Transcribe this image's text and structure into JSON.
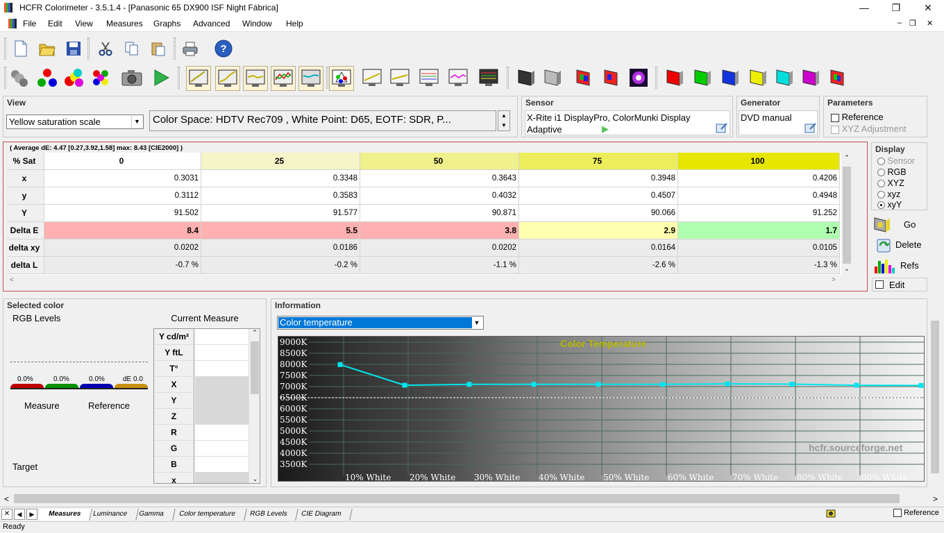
{
  "window": {
    "title": "HCFR Colorimeter - 3.5.1.4 - [Panasonic 65 DX900 ISF Night Fábrica]"
  },
  "menu": [
    "File",
    "Edit",
    "View",
    "Measures",
    "Graphs",
    "Advanced",
    "Window",
    "Help"
  ],
  "view": {
    "title": "View",
    "scale_select": "Yellow saturation scale",
    "color_space_info": "Color Space: HDTV Rec709 , White Point: D65, EOTF:  SDR, P..."
  },
  "sensor": {
    "title": "Sensor",
    "name": "X-Rite i1 DisplayPro, ColorMunki Display",
    "mode": "Adaptive"
  },
  "generator": {
    "title": "Generator",
    "name": "DVD manual"
  },
  "parameters": {
    "title": "Parameters",
    "reference": "Reference",
    "xyz_adjustment": "XYZ Adjustment"
  },
  "grid": {
    "summary": "( Average dE: 4.47 [0.27,3.92,1.58] max: 8.43 [CIE2000] )",
    "corner": "% Sat",
    "columns": [
      "0",
      "25",
      "50",
      "75",
      "100"
    ],
    "rows": [
      {
        "label": "x",
        "values": [
          "0.3031",
          "0.3348",
          "0.3643",
          "0.3948",
          "0.4206"
        ]
      },
      {
        "label": "y",
        "values": [
          "0.3112",
          "0.3583",
          "0.4032",
          "0.4507",
          "0.4948"
        ]
      },
      {
        "label": "Y",
        "values": [
          "91.502",
          "91.577",
          "90.871",
          "90.066",
          "91.252"
        ]
      },
      {
        "label": "Delta E",
        "values": [
          "8.4",
          "5.5",
          "3.8",
          "2.9",
          "1.7"
        ]
      },
      {
        "label": "delta xy",
        "values": [
          "0.0202",
          "0.0186",
          "0.0202",
          "0.0164",
          "0.0105"
        ]
      },
      {
        "label": "delta L",
        "values": [
          "-0.7 %",
          "-0.2 %",
          "-1.1 %",
          "-2.6 %",
          "-1.3 %"
        ]
      }
    ],
    "header_colors": [
      "#ffffff",
      "#f5f5c8",
      "#f0f08c",
      "#eded5c",
      "#e6e600"
    ],
    "delta_e_colors": [
      "#ffb0b0",
      "#ffb0b0",
      "#ffb0b0",
      "#ffffb0",
      "#b0ffb0"
    ]
  },
  "display": {
    "title": "Display",
    "options": [
      "Sensor",
      "RGB",
      "XYZ",
      "xyz",
      "xyY"
    ],
    "selected": "xyY",
    "go": "Go",
    "delete": "Delete",
    "refs": "Refs",
    "edit": "Edit"
  },
  "selected_color": {
    "title": "Selected color",
    "rgb_levels": "RGB Levels",
    "levels": [
      "0.0%",
      "0.0%",
      "0.0%",
      "dE 0.0"
    ],
    "measure": "Measure",
    "reference": "Reference",
    "target": "Target",
    "current_measure": "Current Measure",
    "props": [
      "Y cd/m²",
      "Y ftL",
      "T°",
      "X",
      "Y",
      "Z",
      "R",
      "G",
      "B",
      "x"
    ]
  },
  "information": {
    "title": "Information",
    "select": "Color temperature",
    "chart_title": "Color Temperature",
    "watermark": "hcfr.sourceforge.net"
  },
  "chart_data": {
    "type": "line",
    "title": "Color Temperature",
    "y_ticks": [
      "9000K",
      "8500K",
      "8000K",
      "7500K",
      "7000K",
      "6500K",
      "6000K",
      "5500K",
      "5000K",
      "4500K",
      "4000K",
      "3500K"
    ],
    "x_ticks": [
      "10% White",
      "20% White",
      "30% White",
      "40% White",
      "50% White",
      "60% White",
      "70% White",
      "80% White",
      "90% White"
    ],
    "ylim": [
      3000,
      9000
    ],
    "reference_line": 6500,
    "series": [
      {
        "values": [
          7990,
          7060,
          7100,
          7100,
          7100,
          7100,
          7120,
          7110,
          7060,
          7050
        ],
        "color": "#00e5ee"
      }
    ]
  },
  "tabs": [
    "Measures",
    "Luminance",
    "Gamma",
    "Color temperature",
    "RGB Levels",
    "CIE Diagram"
  ],
  "status": {
    "text": "Ready",
    "reference": "Reference"
  }
}
